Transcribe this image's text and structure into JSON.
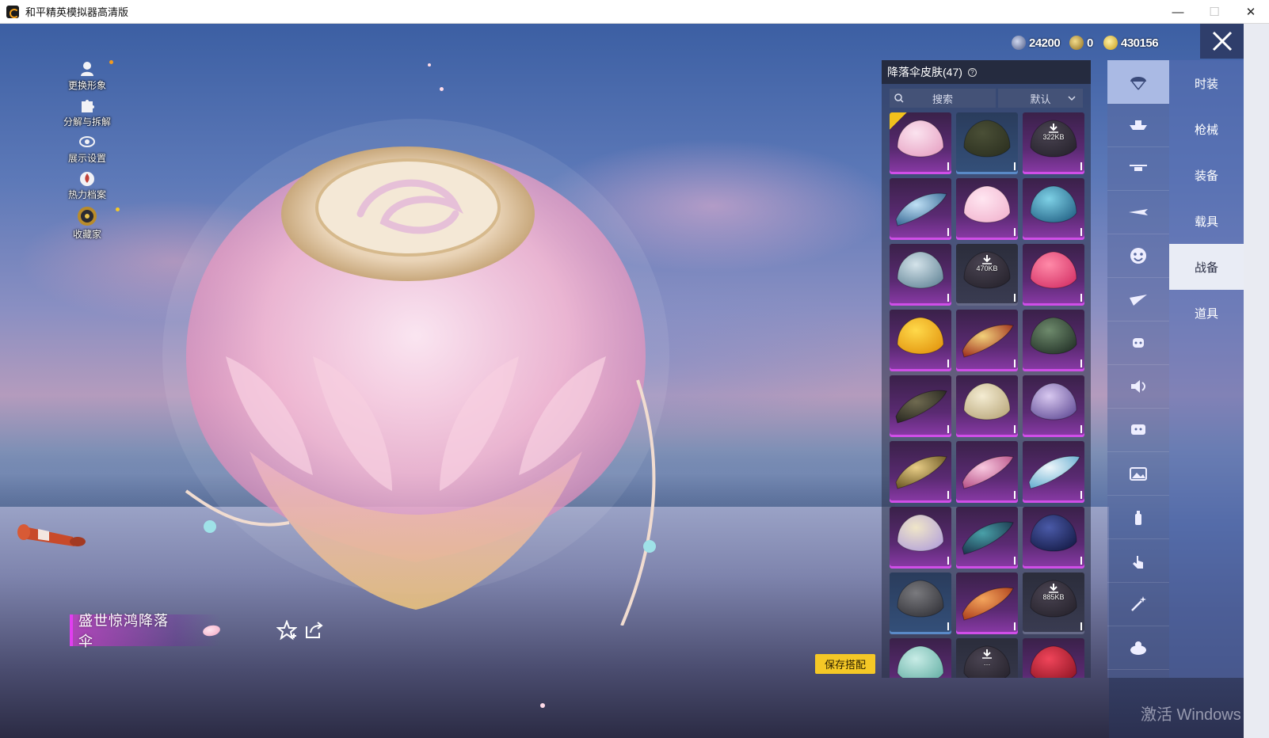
{
  "window": {
    "title": "和平精英模拟器高清版",
    "minimize": "—",
    "maximize": "☐",
    "close": "✕"
  },
  "left_menu": [
    {
      "label": "更换形象",
      "icon": "avatar-icon"
    },
    {
      "label": "分解与拆解",
      "icon": "puzzle-icon"
    },
    {
      "label": "展示设置",
      "icon": "eye-icon"
    },
    {
      "label": "热力档案",
      "icon": "flame-icon"
    },
    {
      "label": "收藏家",
      "icon": "collector-badge-icon"
    }
  ],
  "currency": [
    {
      "value": "24200",
      "icon": "silver-coin-icon",
      "color": "#6f7fa8"
    },
    {
      "value": "0",
      "icon": "gold-medal-icon",
      "color": "#c9a64a"
    },
    {
      "value": "430156",
      "icon": "gold-coin-icon",
      "color": "#e2c23c"
    }
  ],
  "panel": {
    "title": "降落伞皮肤(47)",
    "help": "?",
    "search_placeholder": "搜索",
    "sort_label": "默认"
  },
  "grid": [
    {
      "style": "purple",
      "shape": "pink",
      "equipped": true
    },
    {
      "style": "blue",
      "shape": "olive"
    },
    {
      "style": "purple",
      "shape": "dlc",
      "download": "322KB"
    },
    {
      "style": "purple",
      "shape": "wing-blue"
    },
    {
      "style": "purple",
      "shape": "cat-pink"
    },
    {
      "style": "purple",
      "shape": "teal"
    },
    {
      "style": "purple",
      "shape": "silver"
    },
    {
      "style": "dark",
      "shape": "dlc",
      "download": "470KB"
    },
    {
      "style": "purple",
      "shape": "red-pink"
    },
    {
      "style": "purple",
      "shape": "yellow"
    },
    {
      "style": "purple",
      "shape": "wing-floral"
    },
    {
      "style": "purple",
      "shape": "green-dark"
    },
    {
      "style": "purple",
      "shape": "wing-dark"
    },
    {
      "style": "purple",
      "shape": "cream"
    },
    {
      "style": "purple",
      "shape": "lilac"
    },
    {
      "style": "purple",
      "shape": "wing-gold"
    },
    {
      "style": "purple",
      "shape": "wing-pink"
    },
    {
      "style": "purple",
      "shape": "wing-white"
    },
    {
      "style": "purple",
      "shape": "pastel"
    },
    {
      "style": "purple",
      "shape": "wing-teal"
    },
    {
      "style": "purple",
      "shape": "navy"
    },
    {
      "style": "blue",
      "shape": "cat-gray"
    },
    {
      "style": "purple",
      "shape": "wing-orange"
    },
    {
      "style": "dark",
      "shape": "dlc",
      "download": "885KB"
    },
    {
      "style": "purple",
      "shape": "mint"
    },
    {
      "style": "dark",
      "shape": "dlc",
      "download": "…"
    },
    {
      "style": "purple",
      "shape": "red"
    }
  ],
  "rail": [
    {
      "icon": "parachute-icon",
      "active": true
    },
    {
      "icon": "boat-icon"
    },
    {
      "icon": "drone-icon"
    },
    {
      "icon": "plane-icon"
    },
    {
      "icon": "emote-face-icon"
    },
    {
      "icon": "glider-icon"
    },
    {
      "icon": "robot-icon"
    },
    {
      "icon": "speaker-icon"
    },
    {
      "icon": "chat-icon"
    },
    {
      "icon": "picture-icon"
    },
    {
      "icon": "spray-icon"
    },
    {
      "icon": "tap-icon"
    },
    {
      "icon": "magic-wand-icon"
    },
    {
      "icon": "chicken-icon"
    }
  ],
  "tabs": [
    {
      "label": "时装"
    },
    {
      "label": "枪械"
    },
    {
      "label": "装备"
    },
    {
      "label": "载具"
    },
    {
      "label": "战备",
      "active": true
    },
    {
      "label": "道具"
    }
  ],
  "item_name": "盛世惊鸿降落伞",
  "save_button": "保存搭配",
  "watermark": "激活 Windows",
  "colors": {
    "accent": "#e13ef0",
    "save": "#f5c826",
    "panel": "#282e46"
  }
}
